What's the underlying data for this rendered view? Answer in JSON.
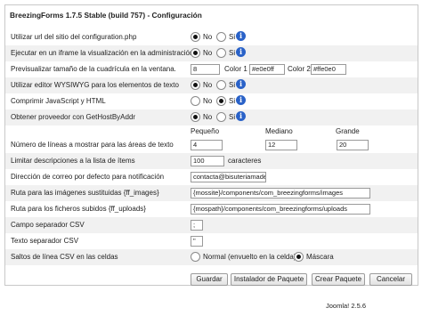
{
  "title": "BreezingForms 1.7.5 Stable (build 757) - Configuración",
  "options": {
    "no": "No",
    "si": "Si"
  },
  "rows": {
    "url_config": {
      "label": "Utilizar url del sitio del configuration.php",
      "selected": "No"
    },
    "iframe_admin": {
      "label": "Ejecutar en un iframe la visualización en la administración",
      "selected": "No"
    },
    "grid": {
      "label": "Previsualizar tamaño de la cuadrícula en la ventana.",
      "size": "8",
      "color1_label": "Color 1",
      "color1": "#e0e0ff",
      "color2_label": "Color 2",
      "color2": "#ffe0e0"
    },
    "wysiwyg": {
      "label": "Utilizar editor WYSIWYG para los elementos de texto",
      "selected": "No"
    },
    "compress_js": {
      "label": "Comprimir JavaScript y HTML",
      "selected": "Si"
    },
    "gethostbyaddr": {
      "label": "Obtener proveedor con GetHostByAddr",
      "selected": "No"
    },
    "textarea_lines": {
      "label": "Número de líneas a mostrar para las áreas de texto",
      "small_label": "Pequeño",
      "small": "4",
      "medium_label": "Mediano",
      "medium": "12",
      "large_label": "Grande",
      "large": "20"
    },
    "list_desc": {
      "label": "Limitar descripciones a la lista de ítems",
      "value": "100",
      "suffix": "caracteres"
    },
    "email": {
      "label": "Dirección de correo por defecto para notificación",
      "value": "contacta@bisuteriamade"
    },
    "images_path": {
      "label": "Ruta para las imágenes sustituidas {ff_images}",
      "value": "{mossite}/components/com_breezingforms/images"
    },
    "uploads_path": {
      "label": "Ruta para los ficheros subidos {ff_uploads}",
      "value": "{mospath}/components/com_breezingforms/uploads"
    },
    "csv_field_sep": {
      "label": "Campo separador CSV",
      "value": ";"
    },
    "csv_text_sep": {
      "label": "Texto separador CSV",
      "value": "\""
    },
    "csv_newlines": {
      "label": "Saltos de línea CSV en las celdas",
      "option1": "Normal (envuelto en la celda)",
      "option2": "Máscara",
      "selected": "Máscara"
    }
  },
  "buttons": {
    "save": "Guardar",
    "installer": "Instalador de Paquete",
    "create": "Crear Paquete",
    "cancel": "Cancelar"
  },
  "footer": "Joomla! 2.5.6"
}
